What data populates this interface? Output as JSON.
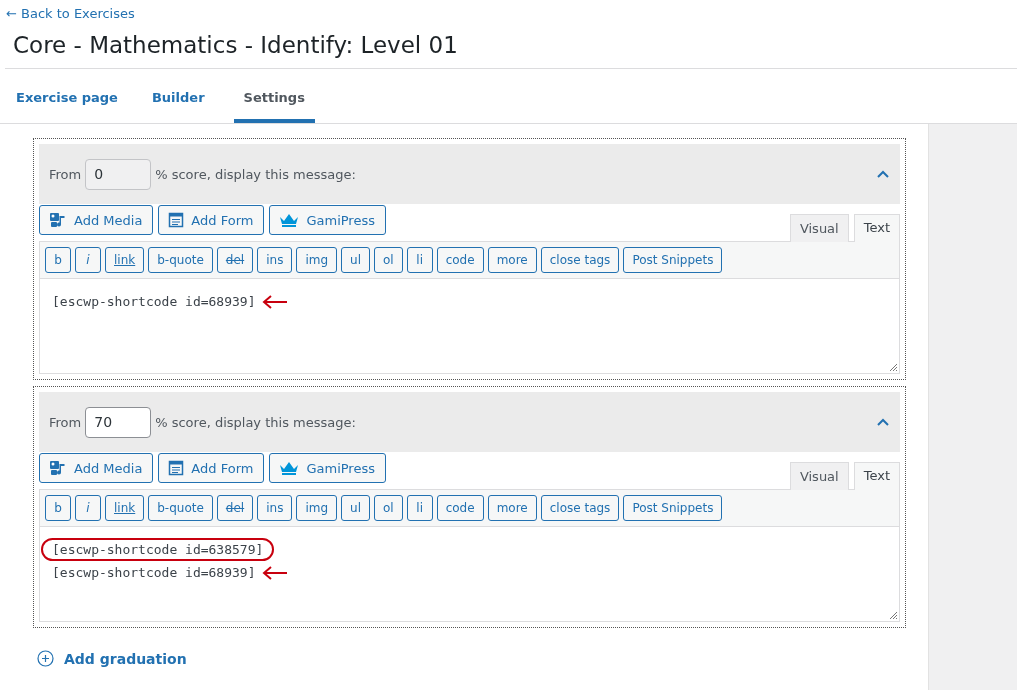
{
  "back_link": "← Back to Exercises",
  "title": "Core - Mathematics - Identify: Level 01",
  "tabs": [
    {
      "label": "Exercise page",
      "selected": false
    },
    {
      "label": "Builder",
      "selected": false
    },
    {
      "label": "Settings",
      "selected": true
    }
  ],
  "graduations": [
    {
      "from_label": "From",
      "score": {
        "value": "0",
        "disabled": true
      },
      "suffix": "% score, display this message:",
      "expanded": true,
      "media_buttons": [
        {
          "label": "Add Media",
          "kind": "media"
        },
        {
          "label": "Add Form",
          "kind": "form"
        },
        {
          "label": "GamiPress",
          "kind": "crown"
        }
      ],
      "editor_tabs": [
        {
          "label": "Visual",
          "selected": false
        },
        {
          "label": "Text",
          "selected": true
        }
      ],
      "quicktags": [
        {
          "label": "b",
          "kind": "plain"
        },
        {
          "label": "i",
          "kind": "italic"
        },
        {
          "label": "link",
          "kind": "underline"
        },
        {
          "label": "b-quote",
          "kind": "plain"
        },
        {
          "label": "del",
          "kind": "strike"
        },
        {
          "label": "ins",
          "kind": "plain"
        },
        {
          "label": "img",
          "kind": "plain"
        },
        {
          "label": "ul",
          "kind": "plain"
        },
        {
          "label": "ol",
          "kind": "plain"
        },
        {
          "label": "li",
          "kind": "plain"
        },
        {
          "label": "code",
          "kind": "plain"
        },
        {
          "label": "more",
          "kind": "plain"
        },
        {
          "label": "close tags",
          "kind": "plain"
        },
        {
          "label": "Post Snippets",
          "kind": "plain"
        }
      ],
      "lines": [
        {
          "text": "[escwp-shortcode id=68939]",
          "kind": "arrow"
        }
      ]
    },
    {
      "from_label": "From",
      "score": {
        "value": "70",
        "disabled": false
      },
      "suffix": "% score, display this message:",
      "expanded": true,
      "media_buttons": [
        {
          "label": "Add Media",
          "kind": "media"
        },
        {
          "label": "Add Form",
          "kind": "form"
        },
        {
          "label": "GamiPress",
          "kind": "crown"
        }
      ],
      "editor_tabs": [
        {
          "label": "Visual",
          "selected": false
        },
        {
          "label": "Text",
          "selected": true
        }
      ],
      "quicktags": [
        {
          "label": "b",
          "kind": "plain"
        },
        {
          "label": "i",
          "kind": "italic"
        },
        {
          "label": "link",
          "kind": "underline"
        },
        {
          "label": "b-quote",
          "kind": "plain"
        },
        {
          "label": "del",
          "kind": "strike"
        },
        {
          "label": "ins",
          "kind": "plain"
        },
        {
          "label": "img",
          "kind": "plain"
        },
        {
          "label": "ul",
          "kind": "plain"
        },
        {
          "label": "ol",
          "kind": "plain"
        },
        {
          "label": "li",
          "kind": "plain"
        },
        {
          "label": "code",
          "kind": "plain"
        },
        {
          "label": "more",
          "kind": "plain"
        },
        {
          "label": "close tags",
          "kind": "plain"
        },
        {
          "label": "Post Snippets",
          "kind": "plain"
        }
      ],
      "lines": [
        {
          "text": "[escwp-shortcode id=638579]",
          "kind": "circle"
        },
        {
          "text": "[escwp-shortcode id=68939]",
          "kind": "arrow"
        }
      ]
    }
  ],
  "add_button": "Add graduation"
}
